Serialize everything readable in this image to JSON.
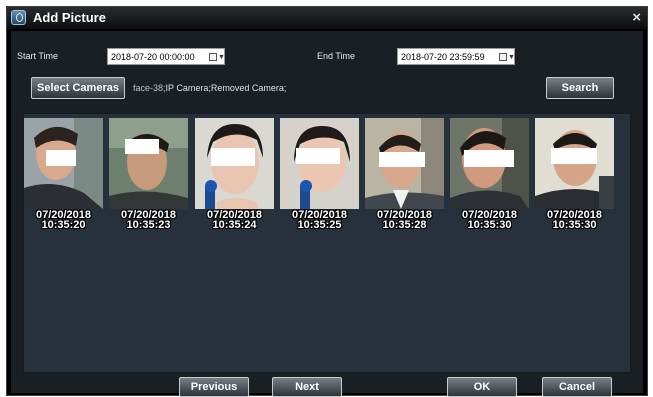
{
  "dialog": {
    "title": "Add Picture",
    "close_glyph": "×"
  },
  "filters": {
    "start_label": "Start Time",
    "start_value": "2018-07-20  00:00:00",
    "end_label": "End Time",
    "end_value": "2018-07-20  23:59:59"
  },
  "cameras": {
    "button_label": "Select Cameras",
    "selected_highlight": "face-38;",
    "selected_rest": "IP Camera;Removed Camera;"
  },
  "search_label": "Search",
  "thumbnails": [
    {
      "date": "07/20/2018",
      "time": "10:35:20"
    },
    {
      "date": "07/20/2018",
      "time": "10:35:23"
    },
    {
      "date": "07/20/2018",
      "time": "10:35:24"
    },
    {
      "date": "07/20/2018",
      "time": "10:35:25"
    },
    {
      "date": "07/20/2018",
      "time": "10:35:28"
    },
    {
      "date": "07/20/2018",
      "time": "10:35:30"
    },
    {
      "date": "07/20/2018",
      "time": "10:35:30"
    }
  ],
  "footer": {
    "previous_label": "Previous",
    "next_label": "Next",
    "ok_label": "OK",
    "cancel_label": "Cancel"
  },
  "colors": {
    "dialog_background": "#1a1f24",
    "gallery_background": "#27313b",
    "button_gradient_top": "#7a7f86",
    "button_gradient_bottom": "#2e3339"
  }
}
